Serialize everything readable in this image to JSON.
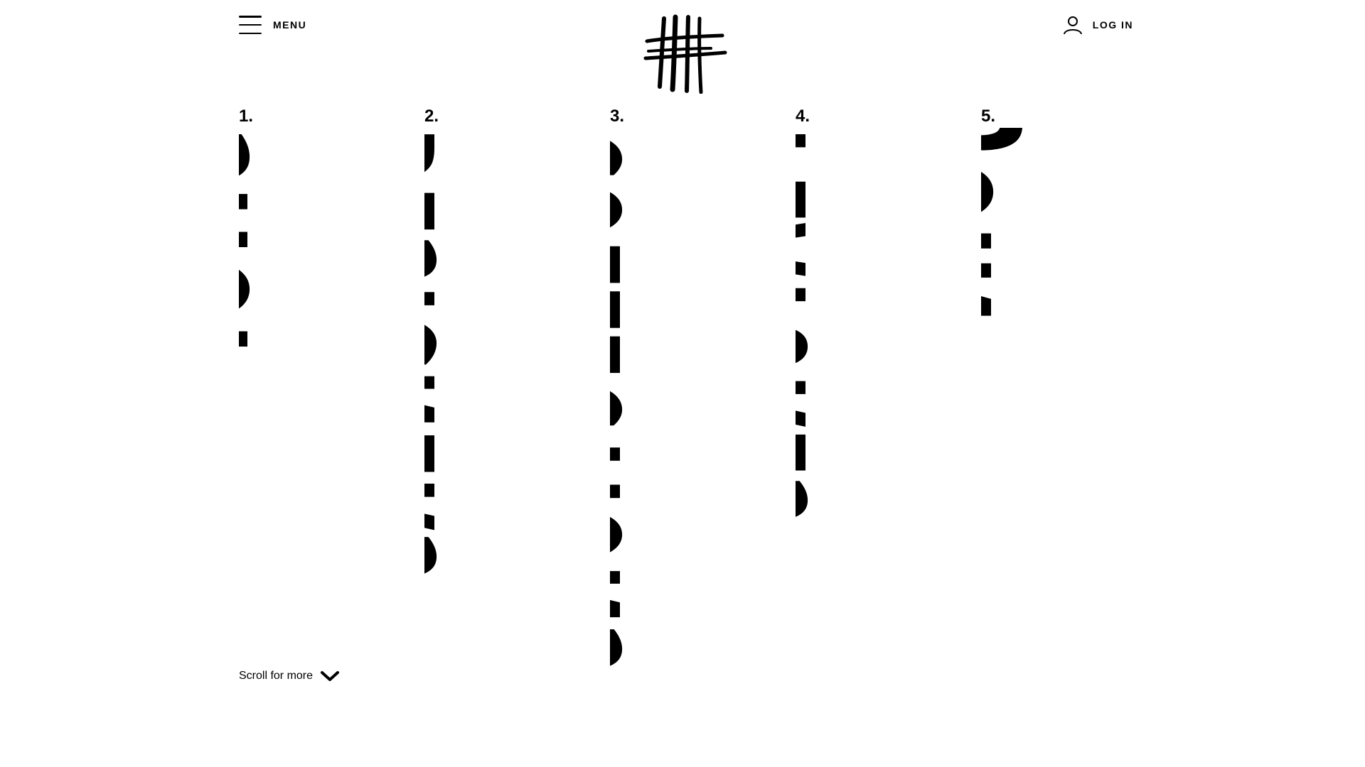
{
  "header": {
    "menu_label": "MENU",
    "login_label": "LOG IN",
    "icons": {
      "menu": "hamburger-icon",
      "logo": "hash-logo",
      "user": "user-icon"
    }
  },
  "nav": {
    "items": [
      {
        "number": "1.",
        "label": "SHOP"
      },
      {
        "number": "2.",
        "label": "DESIGNERS"
      },
      {
        "number": "3.",
        "label": "COLLECTIONS"
      },
      {
        "number": "4.",
        "label": "FEATURES"
      },
      {
        "number": "5.",
        "label": "JOIN"
      }
    ]
  },
  "scroll_hint": {
    "label": "Scroll for more",
    "icon": "chevron-down-icon"
  },
  "colors": {
    "background": "#ffffff",
    "text": "#000000"
  }
}
